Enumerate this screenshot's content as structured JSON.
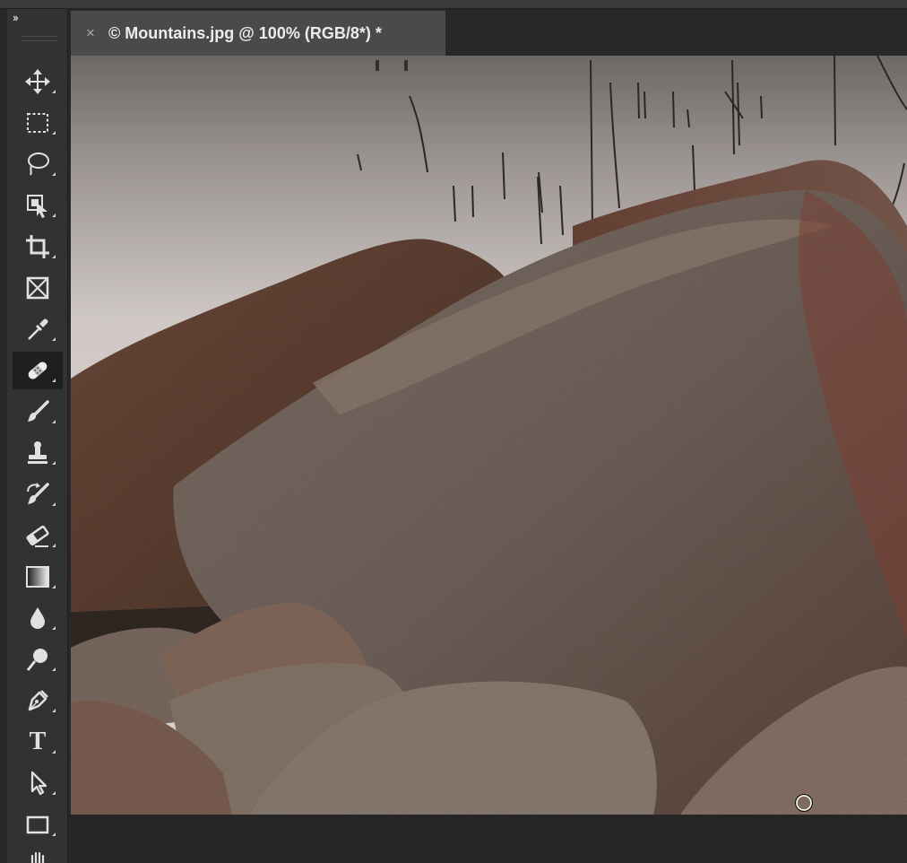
{
  "app": {
    "collapse_glyph": "››",
    "document_tab": {
      "close_glyph": "×",
      "title": "© Mountains.jpg @ 100% (RGB/8*) *"
    }
  },
  "toolbar": {
    "tools": [
      {
        "id": "move",
        "icon": "move-icon",
        "active": false
      },
      {
        "id": "marquee",
        "icon": "rectangular-marquee-icon",
        "active": false
      },
      {
        "id": "lasso",
        "icon": "lasso-icon",
        "active": false
      },
      {
        "id": "object-select",
        "icon": "object-selection-icon",
        "active": false
      },
      {
        "id": "crop",
        "icon": "crop-icon",
        "active": false
      },
      {
        "id": "frame",
        "icon": "frame-icon",
        "active": false
      },
      {
        "id": "eyedropper",
        "icon": "eyedropper-icon",
        "active": false
      },
      {
        "id": "healing",
        "icon": "spot-healing-brush-icon",
        "active": true
      },
      {
        "id": "brush",
        "icon": "brush-icon",
        "active": false
      },
      {
        "id": "stamp",
        "icon": "clone-stamp-icon",
        "active": false
      },
      {
        "id": "history-brush",
        "icon": "history-brush-icon",
        "active": false
      },
      {
        "id": "eraser",
        "icon": "eraser-icon",
        "active": false
      },
      {
        "id": "gradient",
        "icon": "gradient-icon",
        "active": false
      },
      {
        "id": "blur",
        "icon": "blur-drop-icon",
        "active": false
      },
      {
        "id": "dodge",
        "icon": "dodge-icon",
        "active": false
      },
      {
        "id": "pen",
        "icon": "pen-icon",
        "active": false
      },
      {
        "id": "type",
        "icon": "type-icon",
        "active": false,
        "glyph": "T"
      },
      {
        "id": "path-select",
        "icon": "path-selection-arrow-icon",
        "active": false
      },
      {
        "id": "rectangle",
        "icon": "rectangle-shape-icon",
        "active": false
      },
      {
        "id": "hand",
        "icon": "hand-icon",
        "active": false
      }
    ]
  },
  "colors": {
    "toolbar_bg": "#323232",
    "tab_bg": "#4a4a4a",
    "app_bg": "#282828",
    "water": "#cfc7c4",
    "granite": "#7d6f66"
  }
}
